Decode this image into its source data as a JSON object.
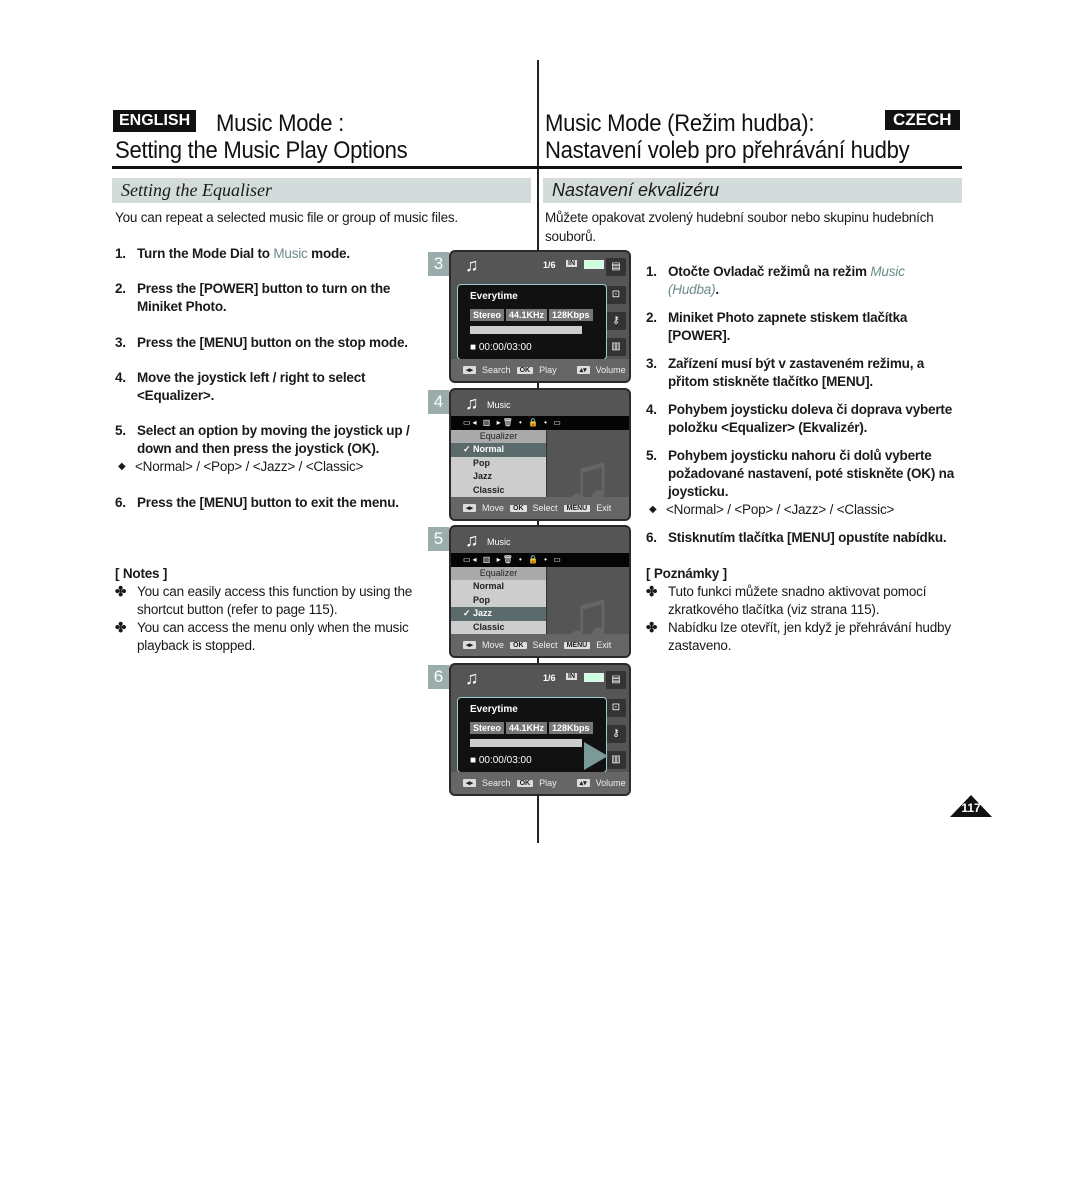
{
  "header": {
    "english_badge": "ENGLISH",
    "czech_badge": "CZECH",
    "en_title1": "Music Mode :",
    "en_title2": "Setting the Music Play Options",
    "cz_title1": "Music Mode (Režim hudba):",
    "cz_title2": "Nastavení voleb pro přehrávání hudby"
  },
  "en": {
    "section": "Setting the Equaliser",
    "intro": "You can repeat a selected music file or group of music files.",
    "steps": [
      {
        "n": "1.",
        "pre": "Turn the Mode Dial to ",
        "accent": "Music",
        "post": " mode."
      },
      {
        "n": "2.",
        "text": "Press the [POWER] button to turn on the Miniket Photo."
      },
      {
        "n": "3.",
        "text": "Press the [MENU] button on the stop mode."
      },
      {
        "n": "4.",
        "text": "Move the joystick left / right to select <Equalizer>."
      },
      {
        "n": "5.",
        "text": "Select an option by moving the joystick up / down and then press the joystick (OK)."
      },
      {
        "n": "6.",
        "text": "Press the [MENU] button to exit the menu."
      }
    ],
    "options": "<Normal> / <Pop> / <Jazz> / <Classic>",
    "notes_title": "[ Notes ]",
    "notes": [
      "You can easily access this function by using the shortcut button (refer to page 115).",
      "You can access the menu only when the music playback is stopped."
    ]
  },
  "cz": {
    "section": "Nastavení ekvalizéru",
    "intro": "Můžete opakovat zvolený hudební soubor nebo skupinu hudebních souborů.",
    "steps": [
      {
        "n": "1.",
        "pre": "Otočte Ovladač režimů na režim ",
        "accent": "Music (Hudba)",
        "post": "."
      },
      {
        "n": "2.",
        "text": "Miniket Photo zapnete stiskem tlačítka [POWER]."
      },
      {
        "n": "3.",
        "text": "Zařízení musí být v  zastaveném režimu, a přitom stiskněte tlačítko [MENU]."
      },
      {
        "n": "4.",
        "text": "Pohybem joysticku doleva či doprava vyberte položku <Equalizer> (Ekvalizér)."
      },
      {
        "n": "5.",
        "text": "Pohybem joysticku nahoru či dolů vyberte požadované nastavení, poté stiskněte (OK) na joysticku."
      },
      {
        "n": "6.",
        "text": "Stisknutím tlačítka [MENU] opustíte nabídku."
      }
    ],
    "options": "<Normal> / <Pop> / <Jazz> / <Classic>",
    "notes_title": "[ Poznámky ]",
    "notes": [
      "Tuto funkci můžete snadno aktivovat pomocí zkratkového tlačítka (viz strana 115).",
      "Nabídku lze otevřít, jen když je přehrávání hudby zastaveno."
    ]
  },
  "player": {
    "count": "1/6",
    "in": "IN",
    "song": "Everytime",
    "stereo": "Stereo",
    "freq": "44.1KHz",
    "bitrate": "128Kbps",
    "time": "00:00/03:00",
    "search": "Search",
    "ok": "OK",
    "play": "Play",
    "volume": "Volume"
  },
  "menu": {
    "title": "Music",
    "header": "Equalizer",
    "items": [
      "Normal",
      "Pop",
      "Jazz",
      "Classic"
    ],
    "move": "Move",
    "ok": "OK",
    "select": "Select",
    "menu_key": "MENU",
    "exit": "Exit",
    "selected_step4": "Normal",
    "selected_step5": "Jazz"
  },
  "screens": {
    "s3": "3",
    "s4": "4",
    "s5": "5",
    "s6": "6"
  },
  "page_number": "117",
  "colors": {
    "accent": "#6a8a8a",
    "section_bar": "#d3dcdb"
  }
}
